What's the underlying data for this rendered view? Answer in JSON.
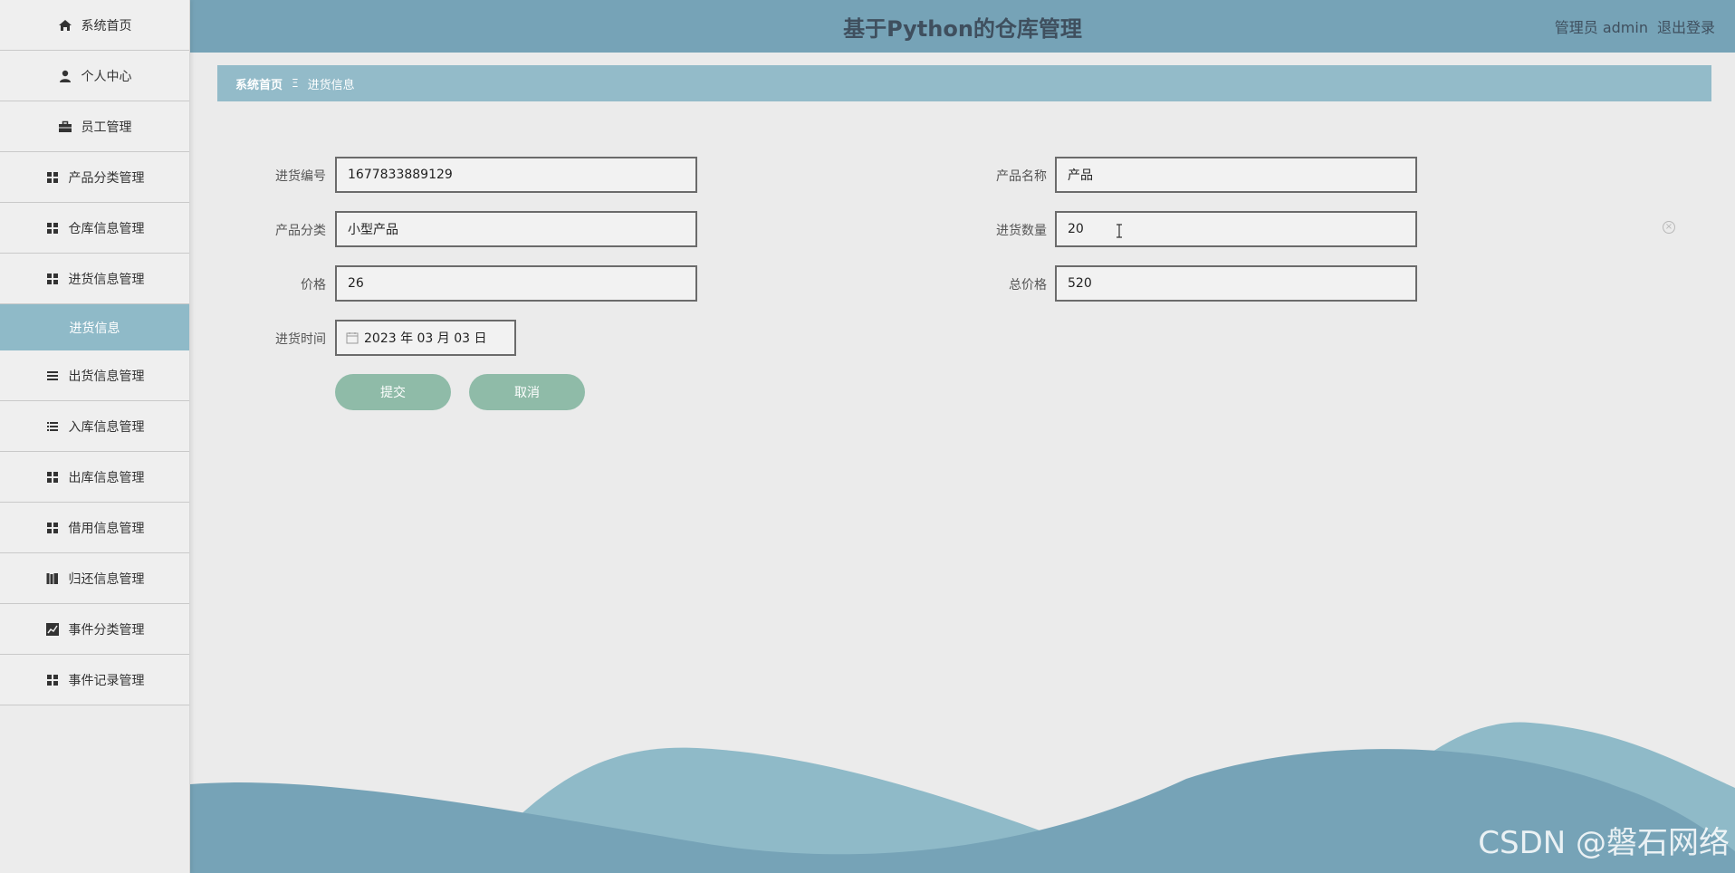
{
  "app": {
    "title": "基于Python的仓库管理",
    "user_label": "管理员 admin",
    "logout_label": "退出登录"
  },
  "sidebar": {
    "items": [
      {
        "label": "系统首页",
        "icon": "home-icon"
      },
      {
        "label": "个人中心",
        "icon": "user-icon"
      },
      {
        "label": "员工管理",
        "icon": "briefcase-icon"
      },
      {
        "label": "产品分类管理",
        "icon": "grid-icon"
      },
      {
        "label": "仓库信息管理",
        "icon": "grid-icon"
      },
      {
        "label": "进货信息管理",
        "icon": "grid-icon"
      },
      {
        "label": "进货信息",
        "icon": ""
      },
      {
        "label": "出货信息管理",
        "icon": "list-icon"
      },
      {
        "label": "入库信息管理",
        "icon": "list-icon"
      },
      {
        "label": "出库信息管理",
        "icon": "grid-icon"
      },
      {
        "label": "借用信息管理",
        "icon": "grid-icon"
      },
      {
        "label": "归还信息管理",
        "icon": "books-icon"
      },
      {
        "label": "事件分类管理",
        "icon": "chart-icon"
      },
      {
        "label": "事件记录管理",
        "icon": "grid-icon"
      }
    ]
  },
  "breadcrumb": {
    "home": "系统首页",
    "separator": "Ξ",
    "current": "进货信息"
  },
  "form": {
    "purchase_no": {
      "label": "进货编号",
      "value": "1677833889129"
    },
    "product_name": {
      "label": "产品名称",
      "value": "产品"
    },
    "category": {
      "label": "产品分类",
      "value": "小型产品"
    },
    "quantity": {
      "label": "进货数量",
      "value": "20"
    },
    "price": {
      "label": "价格",
      "value": "26"
    },
    "total_price": {
      "label": "总价格",
      "value": "520"
    },
    "purchase_time": {
      "label": "进货时间",
      "value": "2023 年 03 月 03 日"
    }
  },
  "buttons": {
    "submit": "提交",
    "cancel": "取消"
  },
  "watermark": "CSDN @磐石网络",
  "colors": {
    "header": "#76a3b7",
    "breadcrumb": "#93bbc9",
    "active_menu": "#8fbac8",
    "button": "#8fbba8",
    "wave_light": "#8fbac8",
    "wave_dark": "#76a3b7"
  }
}
